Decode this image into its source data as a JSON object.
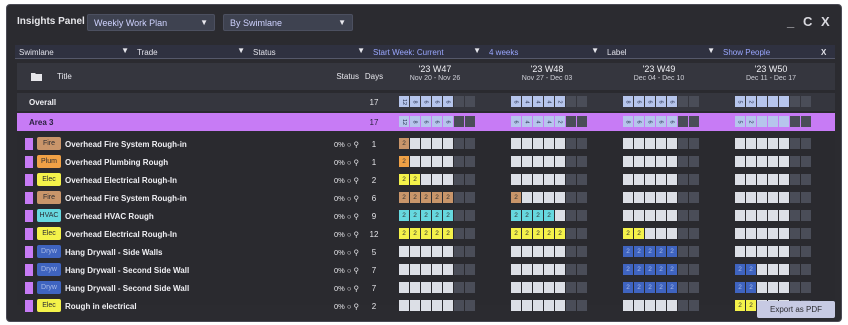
{
  "app": {
    "title": "Insights Panel"
  },
  "top_controls": {
    "plan_select": "Weekly Work Plan",
    "group_select": "By Swimlane",
    "minimize": "_",
    "refresh": "C",
    "close": "X"
  },
  "filters": {
    "swimlane": "Swimlane",
    "trade": "Trade",
    "status": "Status",
    "start_week": "Start Week: Current",
    "range": "4 weeks",
    "label": "Label",
    "show_people": "Show People",
    "clear": "X"
  },
  "columns": {
    "title": "Title",
    "status": "Status",
    "days": "Days"
  },
  "weeks": [
    {
      "label": "'23 W47",
      "dates": "Nov 20 - Nov 26"
    },
    {
      "label": "'23 W48",
      "dates": "Nov 27 - Dec 03"
    },
    {
      "label": "'23 W49",
      "dates": "Dec 04 - Dec 10"
    },
    {
      "label": "'23 W50",
      "dates": "Dec 11 - Dec 17"
    }
  ],
  "summary_rows": [
    {
      "title": "Overall",
      "days": "17",
      "weeks": [
        [
          "12",
          "8",
          "6",
          "6",
          "6",
          "",
          ""
        ],
        [
          "6",
          "4",
          "4",
          "4",
          "2",
          "",
          ""
        ],
        [
          "8",
          "6",
          "6",
          "6",
          "6",
          "",
          ""
        ],
        [
          "5",
          "2",
          "",
          "",
          "",
          "",
          ""
        ]
      ]
    },
    {
      "title": "Area 3",
      "days": "17",
      "weeks": [
        [
          "12",
          "8",
          "6",
          "6",
          "6",
          "",
          ""
        ],
        [
          "6",
          "4",
          "4",
          "4",
          "2",
          "",
          ""
        ],
        [
          "8",
          "6",
          "6",
          "6",
          "6",
          "",
          ""
        ],
        [
          "5",
          "2",
          "",
          "",
          "",
          "",
          ""
        ]
      ]
    }
  ],
  "tasks": [
    {
      "title": "Overhead Fire System Rough-in",
      "trade": "Fire",
      "status": "0% ○ ⚲",
      "days": "1",
      "weeks": [
        [
          "2",
          "",
          "",
          "",
          "",
          "",
          ""
        ],
        [
          "",
          "",
          "",
          "",
          "",
          "",
          ""
        ],
        [
          "",
          "",
          "",
          "",
          "",
          "",
          ""
        ],
        [
          "",
          "",
          "",
          "",
          "",
          "",
          ""
        ]
      ]
    },
    {
      "title": "Overhead Plumbing Rough",
      "trade": "Plum",
      "status": "0% ○ ⚲",
      "days": "1",
      "weeks": [
        [
          "2",
          "",
          "",
          "",
          "",
          "",
          ""
        ],
        [
          "",
          "",
          "",
          "",
          "",
          "",
          ""
        ],
        [
          "",
          "",
          "",
          "",
          "",
          "",
          ""
        ],
        [
          "",
          "",
          "",
          "",
          "",
          "",
          ""
        ]
      ]
    },
    {
      "title": "Overhead Electrical Rough-In",
      "trade": "Elec",
      "status": "0% ○ ⚲",
      "days": "2",
      "weeks": [
        [
          "2",
          "2",
          "",
          "",
          "",
          "",
          ""
        ],
        [
          "",
          "",
          "",
          "",
          "",
          "",
          ""
        ],
        [
          "",
          "",
          "",
          "",
          "",
          "",
          ""
        ],
        [
          "",
          "",
          "",
          "",
          "",
          "",
          ""
        ]
      ]
    },
    {
      "title": "Overhead Fire System Rough-in",
      "trade": "Fire",
      "status": "0% ○ ⚲",
      "days": "6",
      "weeks": [
        [
          "2",
          "2",
          "2",
          "2",
          "2",
          "",
          ""
        ],
        [
          "2",
          "",
          "",
          "",
          "",
          "",
          ""
        ],
        [
          "",
          "",
          "",
          "",
          "",
          "",
          ""
        ],
        [
          "",
          "",
          "",
          "",
          "",
          "",
          ""
        ]
      ]
    },
    {
      "title": "Overhead HVAC Rough",
      "trade": "HVAC",
      "status": "0% ○ ⚲",
      "days": "9",
      "weeks": [
        [
          "2",
          "2",
          "2",
          "2",
          "2",
          "",
          ""
        ],
        [
          "2",
          "2",
          "2",
          "2",
          "",
          "",
          ""
        ],
        [
          "",
          "",
          "",
          "",
          "",
          "",
          ""
        ],
        [
          "",
          "",
          "",
          "",
          "",
          "",
          ""
        ]
      ]
    },
    {
      "title": "Overhead Electrical Rough-In",
      "trade": "Elec",
      "status": "0% ○ ⚲",
      "days": "12",
      "weeks": [
        [
          "2",
          "2",
          "2",
          "2",
          "2",
          "",
          ""
        ],
        [
          "2",
          "2",
          "2",
          "2",
          "2",
          "",
          ""
        ],
        [
          "2",
          "2",
          "",
          "",
          "",
          "",
          ""
        ],
        [
          "",
          "",
          "",
          "",
          "",
          "",
          ""
        ]
      ]
    },
    {
      "title": "Hang Drywall - Side Walls",
      "trade": "Dryw",
      "status": "0% ○ ⚲",
      "days": "5",
      "weeks": [
        [
          "",
          "",
          "",
          "",
          "",
          "",
          ""
        ],
        [
          "",
          "",
          "",
          "",
          "",
          "",
          ""
        ],
        [
          "2",
          "2",
          "2",
          "2",
          "2",
          "",
          ""
        ],
        [
          "",
          "",
          "",
          "",
          "",
          "",
          ""
        ]
      ]
    },
    {
      "title": "Hang Drywall - Second Side Wall",
      "trade": "Dryw",
      "status": "0% ○ ⚲",
      "days": "7",
      "weeks": [
        [
          "",
          "",
          "",
          "",
          "",
          "",
          ""
        ],
        [
          "",
          "",
          "",
          "",
          "",
          "",
          ""
        ],
        [
          "2",
          "2",
          "2",
          "2",
          "2",
          "",
          ""
        ],
        [
          "2",
          "2",
          "",
          "",
          "",
          "",
          ""
        ]
      ]
    },
    {
      "title": "Hang Drywall - Second Side Wall",
      "trade": "Dryw",
      "status": "0% ○ ⚲",
      "days": "7",
      "weeks": [
        [
          "",
          "",
          "",
          "",
          "",
          "",
          ""
        ],
        [
          "",
          "",
          "",
          "",
          "",
          "",
          ""
        ],
        [
          "2",
          "2",
          "2",
          "2",
          "2",
          "",
          ""
        ],
        [
          "2",
          "2",
          "",
          "",
          "",
          "",
          ""
        ]
      ]
    },
    {
      "title": "Rough in electrical",
      "trade": "Elec",
      "status": "0% ○ ⚲",
      "days": "2",
      "weeks": [
        [
          "",
          "",
          "",
          "",
          "",
          "",
          ""
        ],
        [
          "",
          "",
          "",
          "",
          "",
          "",
          ""
        ],
        [
          "",
          "",
          "",
          "",
          "",
          "",
          ""
        ],
        [
          "2",
          "2",
          "",
          "",
          "",
          "",
          ""
        ]
      ]
    }
  ],
  "trade_colors": {
    "Fire": "#c9956a",
    "Plum": "#f0a146",
    "Elec": "#f4f24a",
    "HVAC": "#66d8df",
    "Dryw": "#3f64c0"
  },
  "row_bar_color": "#c77bf5",
  "export_label": "Export as PDF"
}
